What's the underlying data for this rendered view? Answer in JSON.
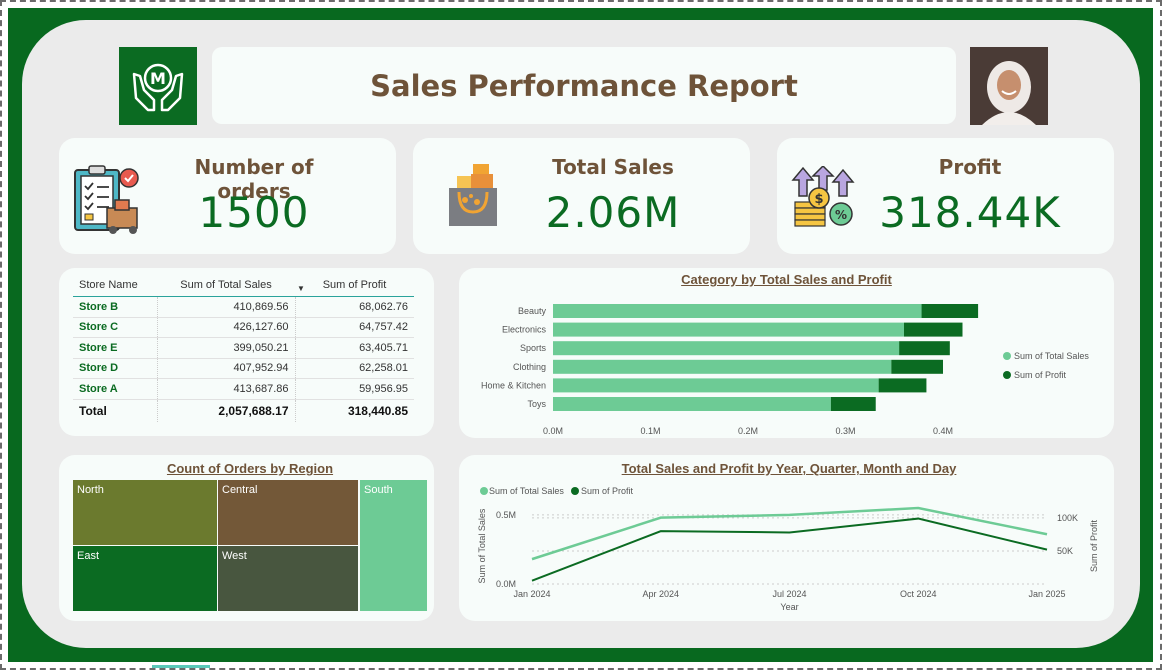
{
  "header": {
    "title": "Sales Performance Report"
  },
  "kpis": {
    "orders": {
      "label": "Number of orders",
      "value": "1500"
    },
    "sales": {
      "label": "Total Sales",
      "value": "2.06M"
    },
    "profit": {
      "label": "Profit",
      "value": "318.44K"
    }
  },
  "store_table": {
    "headers": [
      "Store Name",
      "Sum of Total Sales",
      "Sum of Profit"
    ],
    "rows": [
      {
        "name": "Store B",
        "sales": "410,869.56",
        "profit": "68,062.76"
      },
      {
        "name": "Store C",
        "sales": "426,127.60",
        "profit": "64,757.42"
      },
      {
        "name": "Store E",
        "sales": "399,050.21",
        "profit": "63,405.71"
      },
      {
        "name": "Store D",
        "sales": "407,952.94",
        "profit": "62,258.01"
      },
      {
        "name": "Store A",
        "sales": "413,687.86",
        "profit": "59,956.95"
      }
    ],
    "total": {
      "label": "Total",
      "sales": "2,057,688.17",
      "profit": "318,440.85"
    }
  },
  "chart_data": [
    {
      "type": "bar",
      "title": "Category by Total Sales and Profit",
      "orientation": "horizontal-stacked",
      "categories": [
        "Beauty",
        "Electronics",
        "Sports",
        "Clothing",
        "Home & Kitchen",
        "Toys"
      ],
      "series": [
        {
          "name": "Sum of Total Sales",
          "values": [
            0.378,
            0.36,
            0.355,
            0.347,
            0.334,
            0.285
          ]
        },
        {
          "name": "Sum of Profit",
          "values": [
            0.058,
            0.06,
            0.052,
            0.053,
            0.049,
            0.046
          ]
        }
      ],
      "xticks": [
        "0.0M",
        "0.1M",
        "0.2M",
        "0.3M",
        "0.4M"
      ],
      "xlim": [
        0,
        0.4
      ],
      "legend": "right",
      "colors": {
        "sales": "#6dcb95",
        "profit": "#0b6b22"
      }
    },
    {
      "type": "heatmap",
      "subtype": "treemap",
      "title": "Count of Orders by Region",
      "categories": [
        "North",
        "Central",
        "East",
        "West",
        "South"
      ],
      "colors": {
        "North": "#6b7a2e",
        "Central": "#735838",
        "East": "#0b6b22",
        "West": "#48563f",
        "South": "#6dcb95"
      }
    },
    {
      "type": "line",
      "title": "Total Sales and Profit by Year, Quarter, Month and Day",
      "x": [
        "Jan 2024",
        "Apr 2024",
        "Jul 2024",
        "Oct 2024",
        "Jan 2025"
      ],
      "xlabel": "Year",
      "series": [
        {
          "name": "Sum of Total Sales",
          "axis": "left",
          "values": [
            0.18,
            0.48,
            0.5,
            0.55,
            0.36
          ]
        },
        {
          "name": "Sum of Profit",
          "axis": "right",
          "values": [
            5,
            80,
            78,
            99,
            52
          ]
        }
      ],
      "y_left": {
        "label": "Sum of Total Sales",
        "ticks": [
          "0.0M",
          "0.5M"
        ],
        "lim": [
          0,
          0.55
        ]
      },
      "y_right": {
        "label": "Sum of Profit",
        "ticks": [
          "50K",
          "100K"
        ],
        "lim": [
          0,
          115
        ]
      },
      "legend": "top-left",
      "colors": {
        "sales": "#6dcb95",
        "profit": "#0b6b22"
      }
    }
  ]
}
